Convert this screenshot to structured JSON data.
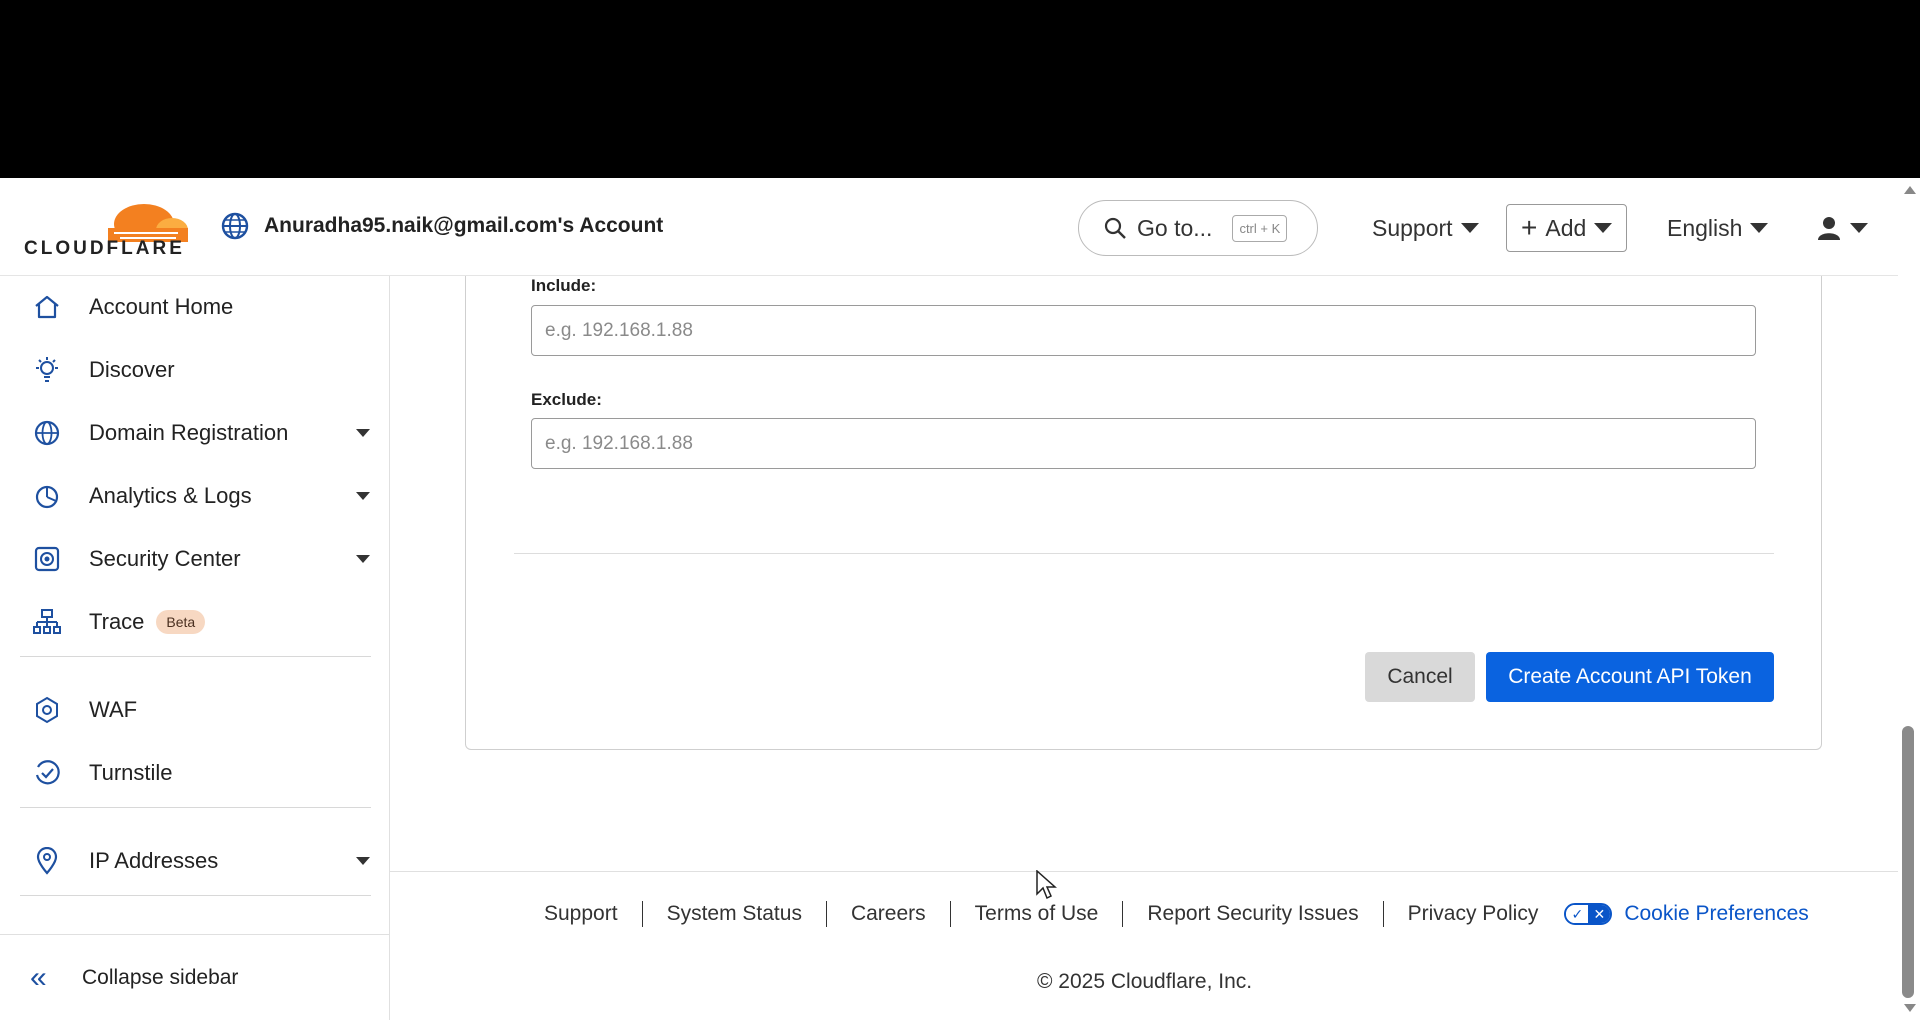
{
  "header": {
    "logo_text": "CLOUDFLARE",
    "account_name": "Anuradha95.naik@gmail.com's Account",
    "goto_label": "Go to...",
    "goto_shortcut": "ctrl + K",
    "support_label": "Support",
    "add_label": "Add",
    "language_label": "English"
  },
  "sidebar": {
    "items": [
      {
        "label": "Account Home",
        "icon": "home-icon"
      },
      {
        "label": "Discover",
        "icon": "lightbulb-icon"
      },
      {
        "label": "Domain Registration",
        "icon": "globe-icon"
      },
      {
        "label": "Analytics & Logs",
        "icon": "pie-chart-icon"
      },
      {
        "label": "Security Center",
        "icon": "security-icon"
      },
      {
        "label": "Trace",
        "badge": "Beta",
        "icon": "trace-icon"
      },
      {
        "label": "WAF",
        "icon": "waf-icon"
      },
      {
        "label": "Turnstile",
        "icon": "turnstile-icon"
      },
      {
        "label": "IP Addresses",
        "icon": "location-pin-icon"
      }
    ],
    "collapse_label": "Collapse sidebar"
  },
  "form": {
    "include_label": "Include:",
    "include_placeholder": "e.g. 192.168.1.88",
    "exclude_label": "Exclude:",
    "exclude_placeholder": "e.g. 192.168.1.88",
    "cancel_label": "Cancel",
    "create_label": "Create Account API Token"
  },
  "footer": {
    "links": [
      "Support",
      "System Status",
      "Careers",
      "Terms of Use",
      "Report Security Issues",
      "Privacy Policy"
    ],
    "cookie_label": "Cookie Preferences",
    "copyright": "© 2025 Cloudflare, Inc."
  },
  "colors": {
    "primary_blue": "#0a63e0",
    "brand_orange": "#f38020",
    "icon_blue": "#1e50a0"
  }
}
